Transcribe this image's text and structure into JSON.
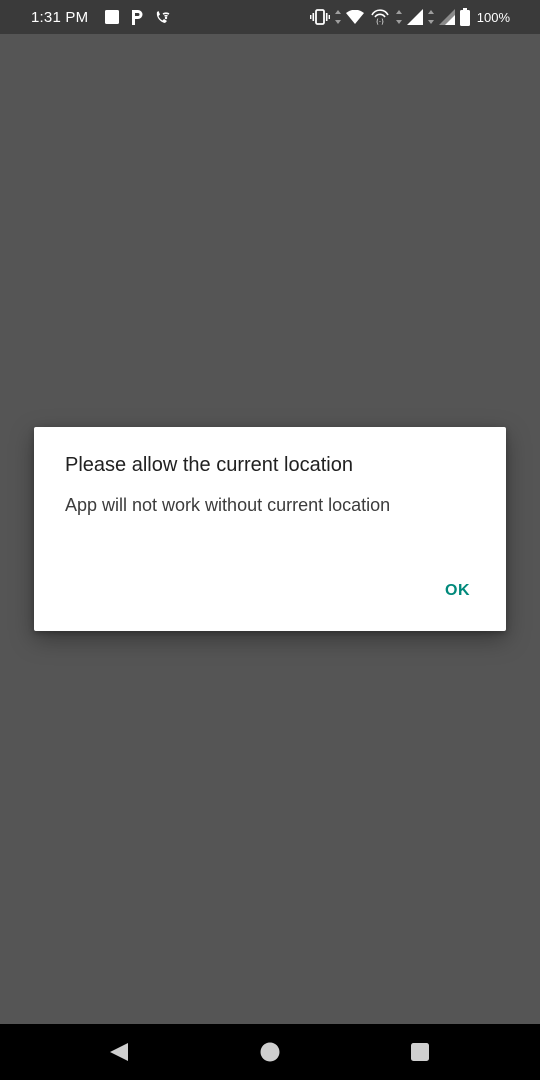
{
  "status_bar": {
    "time": "1:31 PM",
    "battery_percent": "100%",
    "left_icons": [
      "square-notification-icon",
      "parking-icon",
      "phone-wifi-icon"
    ],
    "right_icons": [
      "vibrate-icon",
      "wifi-icon",
      "hotspot-icon",
      "signal-icon",
      "battery-icon"
    ]
  },
  "dialog": {
    "title": "Please allow the current location",
    "message": "App will not work without current location",
    "ok_label": "OK",
    "ok_color": "#00897b"
  },
  "nav_bar": {
    "buttons": [
      "back-icon",
      "home-icon",
      "recents-icon"
    ]
  },
  "colors": {
    "background": "#555555",
    "status_bar": "#3a3a3a",
    "nav_bar": "#000000"
  }
}
